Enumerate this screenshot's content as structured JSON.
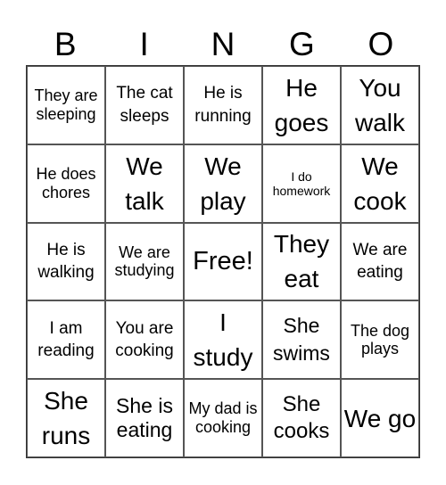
{
  "header": {
    "letters": [
      "B",
      "I",
      "N",
      "G",
      "O"
    ]
  },
  "cells": [
    [
      "They are sleeping",
      "The cat sleeps",
      "He is running",
      "He goes",
      "You walk"
    ],
    [
      "He does chores",
      "We talk",
      "We play",
      "I do homework",
      "We cook"
    ],
    [
      "He is walking",
      "We are studying",
      "Free!",
      "They eat",
      "We are eating"
    ],
    [
      "I am reading",
      "You are cooking",
      "I study",
      "She swims",
      "The dog plays"
    ],
    [
      "She runs",
      "She is eating",
      "My dad is cooking",
      "She cooks",
      "We go"
    ]
  ]
}
